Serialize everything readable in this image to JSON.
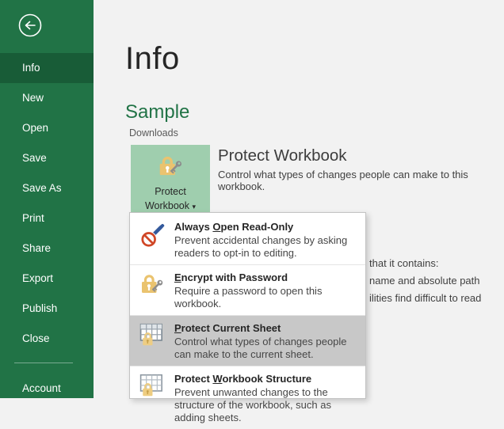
{
  "sidebar": {
    "items": [
      {
        "label": "Info",
        "selected": true
      },
      {
        "label": "New"
      },
      {
        "label": "Open"
      },
      {
        "label": "Save"
      },
      {
        "label": "Save As"
      },
      {
        "label": "Print"
      },
      {
        "label": "Share"
      },
      {
        "label": "Export"
      },
      {
        "label": "Publish"
      },
      {
        "label": "Close"
      }
    ],
    "account_label": "Account",
    "bg_color": "#217346",
    "selected_bg_color": "#185c37"
  },
  "main": {
    "page_title": "Info",
    "doc_title": "Sample",
    "doc_location": "Downloads",
    "protect_button": {
      "line1": "Protect",
      "line2": "Workbook",
      "caret": "▾",
      "bg_color": "#9fceae"
    },
    "section": {
      "title": "Protect Workbook",
      "description": "Control what types of changes people can make to this workbook."
    },
    "inspect_fragments": {
      "line1": "that it contains:",
      "line2": "name and absolute path",
      "line3": "ilities find difficult to read"
    }
  },
  "menu": {
    "highlight_color": "#c8c8c8",
    "items": [
      {
        "icon": "pen-slash-icon",
        "title_pre": "Always ",
        "title_key": "O",
        "title_post": "pen Read-Only",
        "description": "Prevent accidental changes by asking readers to opt-in to editing."
      },
      {
        "icon": "lock-key-icon",
        "title_pre": "",
        "title_key": "E",
        "title_post": "ncrypt with Password",
        "description": "Require a password to open this workbook."
      },
      {
        "icon": "sheet-lock-icon",
        "title_pre": "",
        "title_key": "P",
        "title_post": "rotect Current Sheet",
        "description": "Control what types of changes people can make to the current sheet."
      },
      {
        "icon": "workbook-lock-icon",
        "title_pre": "Protect ",
        "title_key": "W",
        "title_post": "orkbook Structure",
        "description": "Prevent unwanted changes to the structure of the workbook, such as adding sheets."
      }
    ]
  },
  "colors": {
    "accent_green": "#217346",
    "button_green": "#9fceae",
    "lock_gold": "#eac36f",
    "key_gray": "#8c8c8c",
    "pen_blue": "#33599c",
    "prohibit_red": "#d04727",
    "main_bg": "#f2f2f2"
  }
}
